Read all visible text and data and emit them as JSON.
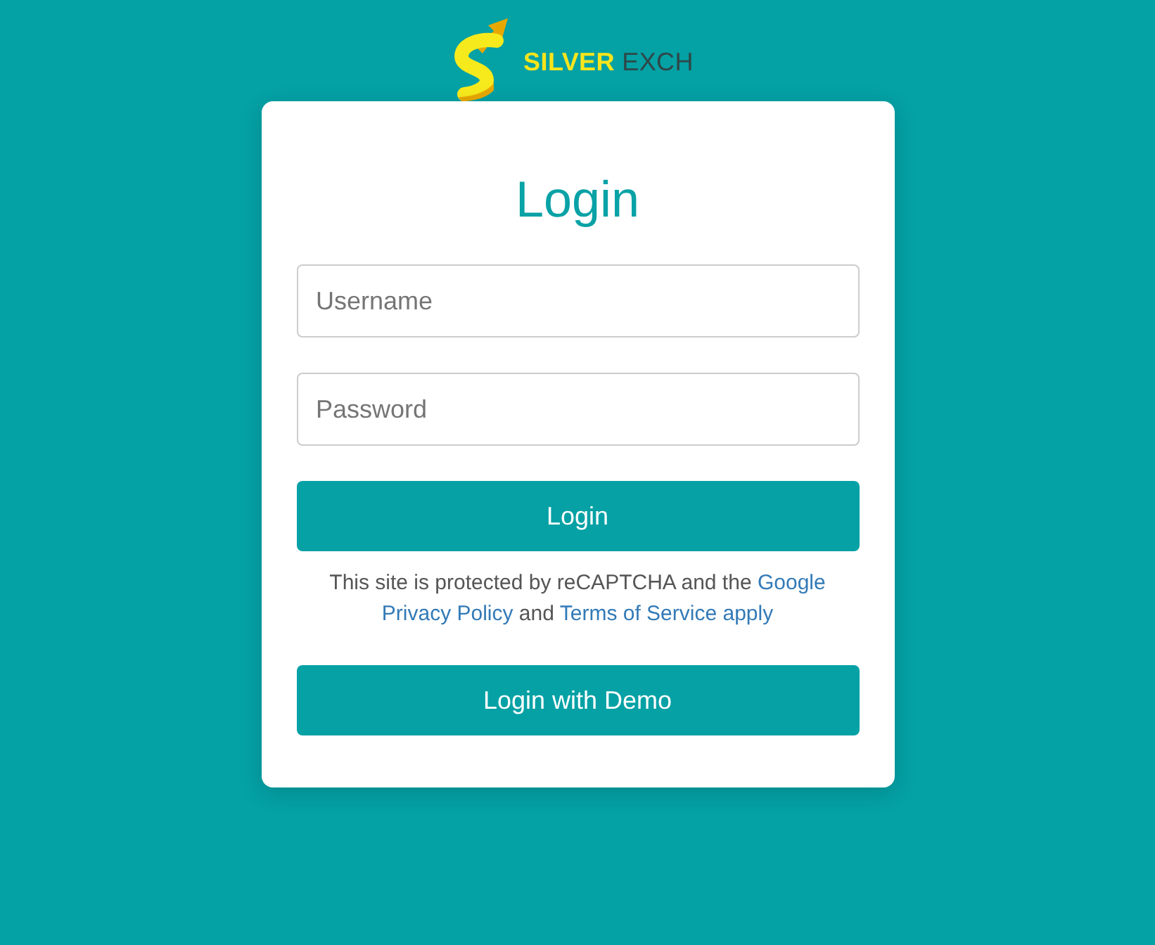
{
  "logo": {
    "brand": "SILVER",
    "suffix": "EXCH"
  },
  "login_card": {
    "title": "Login",
    "fields": [
      {
        "placeholder": "Username"
      },
      {
        "placeholder": "Password"
      }
    ],
    "submit_button": "Login",
    "notice": {
      "lines": [
        [
          {
            "kind": "text",
            "text": "This site is protected by reCAPTCHA and the "
          },
          {
            "kind": "link",
            "text": "Google"
          }
        ],
        [
          {
            "kind": "link",
            "text": "Privacy Policy"
          },
          {
            "kind": "text",
            "text": " and "
          },
          {
            "kind": "link",
            "text": "Terms of Service apply"
          }
        ]
      ]
    },
    "demo_button": "Login with Demo"
  }
}
